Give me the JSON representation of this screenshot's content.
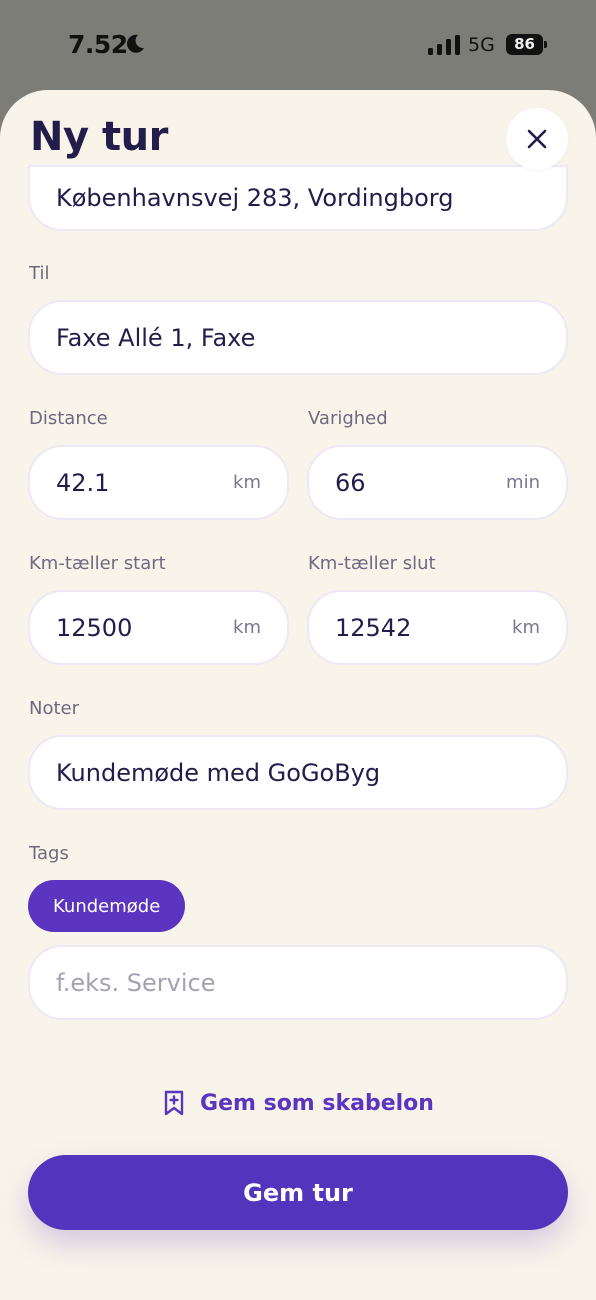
{
  "status_bar": {
    "time": "7.52",
    "network": "5G",
    "battery": "86"
  },
  "sheet": {
    "title": "Ny tur",
    "from_value": "Københavnsvej 283, Vordingborg",
    "to": {
      "label": "Til",
      "value": "Faxe Allé 1, Faxe"
    },
    "distance": {
      "label": "Distance",
      "value": "42.1",
      "unit": "km"
    },
    "duration": {
      "label": "Varighed",
      "value": "66",
      "unit": "min"
    },
    "odometer_start": {
      "label": "Km-tæller start",
      "value": "12500",
      "unit": "km"
    },
    "odometer_end": {
      "label": "Km-tæller slut",
      "value": "12542",
      "unit": "km"
    },
    "notes": {
      "label": "Noter",
      "value": "Kundemøde med GoGoByg"
    },
    "tags": {
      "label": "Tags",
      "items": [
        "Kundemøde"
      ],
      "placeholder": "f.eks. Service"
    },
    "save_template_label": "Gem som skabelon",
    "save_label": "Gem tur"
  },
  "colors": {
    "accent": "#5b34c0",
    "sheet_bg": "#f9f4ea",
    "title": "#221d4a"
  }
}
